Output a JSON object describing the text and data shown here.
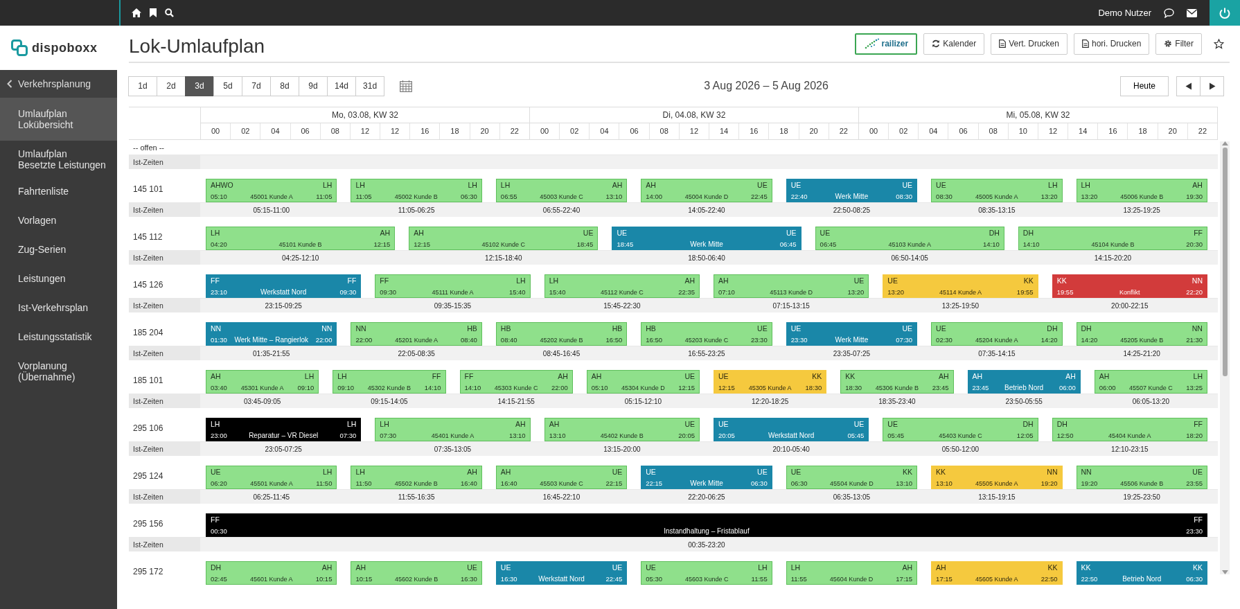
{
  "topbar": {
    "user": "Demo Nutzer"
  },
  "logo": {
    "text": "dispoboxx"
  },
  "sidebar": {
    "header": "Verkehrsplanung",
    "items": [
      {
        "label": "Umlaufplan Lokübersicht",
        "selected": true
      },
      {
        "label": "Umlaufplan Besetzte Leistungen",
        "selected": false
      },
      {
        "label": "Fahrtenliste",
        "selected": false
      },
      {
        "label": "Vorlagen",
        "selected": false
      },
      {
        "label": "Zug-Serien",
        "selected": false
      },
      {
        "label": "Leistungen",
        "selected": false
      },
      {
        "label": "Ist-Verkehrsplan",
        "selected": false
      },
      {
        "label": "Leistungsstatistik",
        "selected": false
      },
      {
        "label": "Vorplanung (Übernahme)",
        "selected": false
      }
    ]
  },
  "title": "Lok-Umlaufplan",
  "header_buttons": [
    {
      "kind": "brand",
      "label": "railizer"
    },
    {
      "kind": "refresh",
      "label": "Kalender"
    },
    {
      "kind": "document",
      "label": "Vert. Drucken"
    },
    {
      "kind": "document",
      "label": "hori. Drucken"
    },
    {
      "kind": "gear",
      "label": "Filter"
    }
  ],
  "ranges": [
    {
      "label": "1d",
      "selected": false
    },
    {
      "label": "2d",
      "selected": false
    },
    {
      "label": "3d",
      "selected": true
    },
    {
      "label": "5d",
      "selected": false
    },
    {
      "label": "7d",
      "selected": false
    },
    {
      "label": "8d",
      "selected": false
    },
    {
      "label": "9d",
      "selected": false
    },
    {
      "label": "14d",
      "selected": false
    },
    {
      "label": "31d",
      "selected": false
    }
  ],
  "date_range": "3 Aug 2026 – 5 Aug 2026",
  "today_button": "Heute",
  "days": [
    {
      "label": "Mo, 03.08, KW 32",
      "hours": [
        "00",
        "02",
        "04",
        "06",
        "08",
        "12",
        "12",
        "16",
        "18",
        "20",
        "22"
      ]
    },
    {
      "label": "Di, 04.08, KW 32",
      "hours": [
        "00",
        "02",
        "04",
        "06",
        "08",
        "12",
        "14",
        "16",
        "18",
        "20",
        "22"
      ]
    },
    {
      "label": "Mi, 05.08, KW 32",
      "hours": [
        "00",
        "02",
        "04",
        "06",
        "08",
        "10",
        "12",
        "14",
        "16",
        "18",
        "20",
        "22"
      ]
    }
  ],
  "open_row": {
    "label": "-- offen --",
    "ist_label": "Ist-Zeiten"
  },
  "lanes": [
    {
      "name": "145 101",
      "ist_label": "Ist-Zeiten",
      "bars": [
        {
          "kind": "trip",
          "from": "AHWO",
          "to": "LH",
          "start": "05:10",
          "label": "45001 Kunde A",
          "end": "11:05",
          "actual": "05:15-11:00"
        },
        {
          "kind": "trip",
          "from": "LH",
          "to": "LH",
          "start": "11:05",
          "label": "45002 Kunde B",
          "end": "06:30",
          "actual": "11:05-06:25"
        },
        {
          "kind": "trip",
          "from": "LH",
          "to": "AH",
          "start": "06:55",
          "label": "45003 Kunde C",
          "end": "13:10",
          "actual": "06:55-22:40"
        },
        {
          "kind": "trip",
          "from": "AH",
          "to": "UE",
          "start": "14:00",
          "label": "45004 Kunde D",
          "end": "22:45",
          "actual": "14:05-22:40"
        },
        {
          "kind": "workshop",
          "from": "UE",
          "to": "UE",
          "start": "22:40",
          "label": "Werk Mitte",
          "end": "08:30",
          "actual": "22:50-08:25"
        },
        {
          "kind": "trip",
          "from": "UE",
          "to": "LH",
          "start": "08:30",
          "label": "45005 Kunde A",
          "end": "13:20",
          "actual": "08:35-13:15"
        },
        {
          "kind": "trip",
          "from": "LH",
          "to": "AH",
          "start": "13:20",
          "label": "45006 Kunde B",
          "end": "19:30",
          "actual": "13:25-19:25"
        }
      ]
    },
    {
      "name": "145 112",
      "ist_label": "Ist-Zeiten",
      "bars": [
        {
          "kind": "trip",
          "from": "LH",
          "to": "AH",
          "start": "04:20",
          "label": "45101 Kunde B",
          "end": "12:15",
          "actual": "04:25-12:10"
        },
        {
          "kind": "trip",
          "from": "AH",
          "to": "UE",
          "start": "12:15",
          "label": "45102 Kunde C",
          "end": "18:45",
          "actual": "12:15-18:40"
        },
        {
          "kind": "workshop",
          "from": "UE",
          "to": "UE",
          "start": "18:45",
          "label": "Werk Mitte",
          "end": "06:45",
          "actual": "18:50-06:40"
        },
        {
          "kind": "trip",
          "from": "UE",
          "to": "DH",
          "start": "06:45",
          "label": "45103 Kunde A",
          "end": "14:10",
          "actual": "06:50-14:05"
        },
        {
          "kind": "trip",
          "from": "DH",
          "to": "FF",
          "start": "14:10",
          "label": "45104 Kunde B",
          "end": "20:30",
          "actual": "14:15-20:20"
        }
      ]
    },
    {
      "name": "145 126",
      "ist_label": "Ist-Zeiten",
      "bars": [
        {
          "kind": "workshop",
          "from": "FF",
          "to": "FF",
          "start": "23:10",
          "label": "Werkstatt Nord",
          "end": "09:30",
          "actual": "23:15-09:25"
        },
        {
          "kind": "trip",
          "from": "FF",
          "to": "LH",
          "start": "09:30",
          "label": "45111 Kunde A",
          "end": "15:40",
          "actual": "09:35-15:35"
        },
        {
          "kind": "trip",
          "from": "LH",
          "to": "AH",
          "start": "15:40",
          "label": "45112 Kunde C",
          "end": "22:35",
          "actual": "15:45-22:30"
        },
        {
          "kind": "trip",
          "from": "AH",
          "to": "UE",
          "start": "07:10",
          "label": "45113 Kunde D",
          "end": "13:20",
          "actual": "07:15-13:15"
        },
        {
          "kind": "warning",
          "from": "UE",
          "to": "KK",
          "start": "13:20",
          "label": "45114 Kunde A",
          "end": "19:55",
          "actual": "13:25-19:50"
        },
        {
          "kind": "conflict",
          "from": "KK",
          "to": "NN",
          "start": "19:55",
          "label": "Konflikt",
          "end": "22:20",
          "actual": "20:00-22:15"
        }
      ]
    },
    {
      "name": "185 204",
      "ist_label": "Ist-Zeiten",
      "bars": [
        {
          "kind": "workshop",
          "from": "NN",
          "to": "NN",
          "start": "01:30",
          "label": "Werk Mitte – Rangierlok",
          "end": "22:00",
          "actual": "01:35-21:55"
        },
        {
          "kind": "trip",
          "from": "NN",
          "to": "HB",
          "start": "22:00",
          "label": "45201 Kunde A",
          "end": "08:40",
          "actual": "22:05-08:35"
        },
        {
          "kind": "trip",
          "from": "HB",
          "to": "HB",
          "start": "08:40",
          "label": "45202 Kunde B",
          "end": "16:50",
          "actual": "08:45-16:45"
        },
        {
          "kind": "trip",
          "from": "HB",
          "to": "UE",
          "start": "16:50",
          "label": "45203 Kunde C",
          "end": "23:30",
          "actual": "16:55-23:25"
        },
        {
          "kind": "workshop",
          "from": "UE",
          "to": "UE",
          "start": "23:30",
          "label": "Werk Mitte",
          "end": "07:30",
          "actual": "23:35-07:25"
        },
        {
          "kind": "trip",
          "from": "UE",
          "to": "DH",
          "start": "02:30",
          "label": "45204 Kunde A",
          "end": "14:20",
          "actual": "07:35-14:15"
        },
        {
          "kind": "trip",
          "from": "DH",
          "to": "NN",
          "start": "14:20",
          "label": "45205 Kunde B",
          "end": "21:30",
          "actual": "14:25-21:20"
        }
      ]
    },
    {
      "name": "185 101",
      "ist_label": "Ist-Zeiten",
      "bars": [
        {
          "kind": "trip",
          "from": "AH",
          "to": "LH",
          "start": "03:40",
          "label": "45301 Kunde A",
          "end": "09:10",
          "actual": "03:45-09:05"
        },
        {
          "kind": "trip",
          "from": "LH",
          "to": "FF",
          "start": "09:10",
          "label": "45302 Kunde B",
          "end": "14:10",
          "actual": "09:15-14:05"
        },
        {
          "kind": "trip",
          "from": "FF",
          "to": "AH",
          "start": "14:10",
          "label": "45303 Kunde C",
          "end": "22:00",
          "actual": "14:15-21:55"
        },
        {
          "kind": "trip",
          "from": "AH",
          "to": "UE",
          "start": "05:10",
          "label": "45304 Kunde D",
          "end": "12:15",
          "actual": "05:15-12:10"
        },
        {
          "kind": "warning",
          "from": "UE",
          "to": "KK",
          "start": "12:15",
          "label": "45305 Kunde A",
          "end": "18:30",
          "actual": "12:20-18:25"
        },
        {
          "kind": "trip",
          "from": "KK",
          "to": "AH",
          "start": "18:30",
          "label": "45306 Kunde B",
          "end": "23:45",
          "actual": "18:35-23:40"
        },
        {
          "kind": "workshop",
          "from": "AH",
          "to": "AH",
          "start": "23:45",
          "label": "Betrieb Nord",
          "end": "06:00",
          "actual": "23:50-05:55"
        },
        {
          "kind": "trip",
          "from": "AH",
          "to": "LH",
          "start": "06:00",
          "label": "45507 Kunde C",
          "end": "13:25",
          "actual": "06:05-13:20"
        }
      ]
    },
    {
      "name": "295 106",
      "ist_label": "Ist-Zeiten",
      "bars": [
        {
          "kind": "maintenance",
          "from": "LH",
          "to": "LH",
          "start": "23:00",
          "label": "Reparatur – VR Diesel",
          "end": "07:30",
          "actual": "23:05-07:25"
        },
        {
          "kind": "trip",
          "from": "LH",
          "to": "AH",
          "start": "07:30",
          "label": "45401 Kunde A",
          "end": "13:10",
          "actual": "07:35-13:05"
        },
        {
          "kind": "trip",
          "from": "AH",
          "to": "UE",
          "start": "13:10",
          "label": "45402 Kunde B",
          "end": "20:05",
          "actual": "13:15-20:00"
        },
        {
          "kind": "workshop",
          "from": "UE",
          "to": "UE",
          "start": "20:05",
          "label": "Werkstatt Nord",
          "end": "05:45",
          "actual": "20:10-05:40"
        },
        {
          "kind": "trip",
          "from": "UE",
          "to": "DH",
          "start": "05:45",
          "label": "45403 Kunde C",
          "end": "12:05",
          "actual": "05:50-12:00"
        },
        {
          "kind": "trip",
          "from": "DH",
          "to": "FF",
          "start": "12:50",
          "label": "45404 Kunde A",
          "end": "18:20",
          "actual": "12:10-23:15"
        }
      ]
    },
    {
      "name": "295 124",
      "ist_label": "Ist-Zeiten",
      "bars": [
        {
          "kind": "trip",
          "from": "UE",
          "to": "LH",
          "start": "06:20",
          "label": "45501 Kunde A",
          "end": "11:50",
          "actual": "06:25-11:45"
        },
        {
          "kind": "trip",
          "from": "LH",
          "to": "AH",
          "start": "11:50",
          "label": "45502 Kunde B",
          "end": "16:40",
          "actual": "11:55-16:35"
        },
        {
          "kind": "trip",
          "from": "AH",
          "to": "UE",
          "start": "16:40",
          "label": "45503 Kunde C",
          "end": "22:15",
          "actual": "16:45-22:10"
        },
        {
          "kind": "workshop",
          "from": "UE",
          "to": "UE",
          "start": "22:15",
          "label": "Werk Mitte",
          "end": "06:30",
          "actual": "22:20-06:25"
        },
        {
          "kind": "trip",
          "from": "UE",
          "to": "KK",
          "start": "06:30",
          "label": "45504 Kunde D",
          "end": "13:10",
          "actual": "06:35-13:05"
        },
        {
          "kind": "warning",
          "from": "KK",
          "to": "NN",
          "start": "13:10",
          "label": "45505 Kunde A",
          "end": "19:20",
          "actual": "13:15-19:15"
        },
        {
          "kind": "trip",
          "from": "NN",
          "to": "UE",
          "start": "19:20",
          "label": "45506 Kunde B",
          "end": "23:55",
          "actual": "19:25-23:50"
        }
      ]
    },
    {
      "name": "295 156",
      "ist_label": "Ist-Zeiten",
      "bars": [
        {
          "kind": "maintenance",
          "from": "FF",
          "to": "FF",
          "start": "00:30",
          "label": "Instandhaltung – Fristablauf",
          "end": "23:30",
          "actual": "00:35-23:20"
        }
      ]
    },
    {
      "name": "295 172",
      "bars": [
        {
          "kind": "trip",
          "from": "DH",
          "to": "AH",
          "start": "02:45",
          "label": "45601 Kunde A",
          "end": "10:15"
        },
        {
          "kind": "trip",
          "from": "AH",
          "to": "UE",
          "start": "10:15",
          "label": "45602 Kunde B",
          "end": "16:30"
        },
        {
          "kind": "workshop",
          "from": "UE",
          "to": "UE",
          "start": "16:30",
          "label": "Werkstatt Nord",
          "end": "22:45"
        },
        {
          "kind": "trip",
          "from": "UE",
          "to": "LH",
          "start": "05:30",
          "label": "45603 Kunde C",
          "end": "11:55"
        },
        {
          "kind": "trip",
          "from": "LH",
          "to": "AH",
          "start": "11:55",
          "label": "45604 Kunde D",
          "end": "17:15"
        },
        {
          "kind": "warning",
          "from": "AH",
          "to": "KK",
          "start": "17:15",
          "label": "45605 Kunde A",
          "end": "22:50"
        },
        {
          "kind": "workshop",
          "from": "KK",
          "to": "KK",
          "start": "22:50",
          "label": "Betrieb Nord",
          "end": "06:30"
        }
      ]
    }
  ]
}
